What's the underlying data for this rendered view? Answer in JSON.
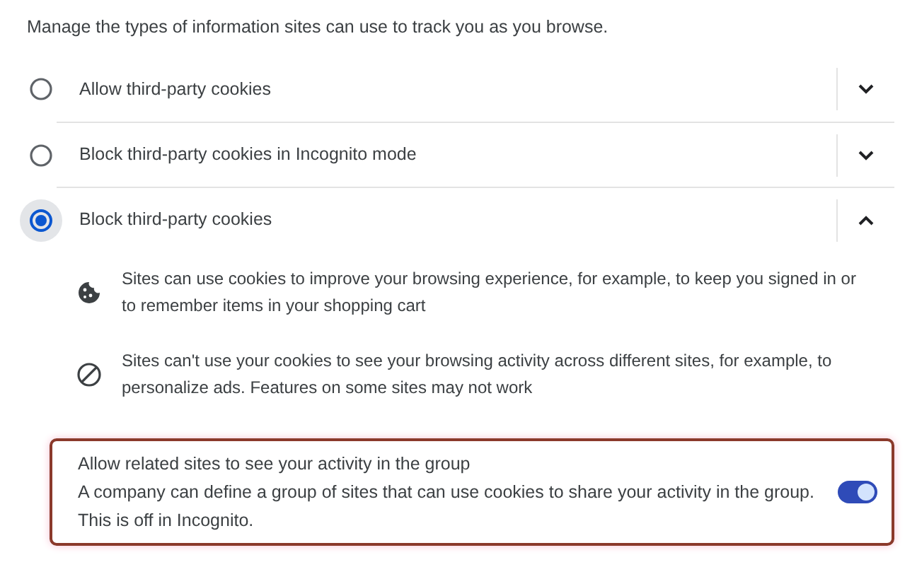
{
  "description": "Manage the types of information sites can use to track you as you browse.",
  "options": [
    {
      "label": "Allow third-party cookies",
      "selected": false,
      "expanded": false
    },
    {
      "label": "Block third-party cookies in Incognito mode",
      "selected": false,
      "expanded": false
    },
    {
      "label": "Block third-party cookies",
      "selected": true,
      "expanded": true
    }
  ],
  "details": [
    {
      "kind": "cookie",
      "text": "Sites can use cookies to improve your browsing experience, for example, to keep you signed in or to remember items in your shopping cart"
    },
    {
      "kind": "block",
      "text": "Sites can't use your cookies to see your browsing activity across different sites, for example, to personalize ads. Features on some sites may not work"
    }
  ],
  "related_sites": {
    "title": "Allow related sites to see your activity in the group",
    "description": "A company can define a group of sites that can use cookies to share your activity in the group.",
    "note": "This is off in Incognito.",
    "on": true
  }
}
